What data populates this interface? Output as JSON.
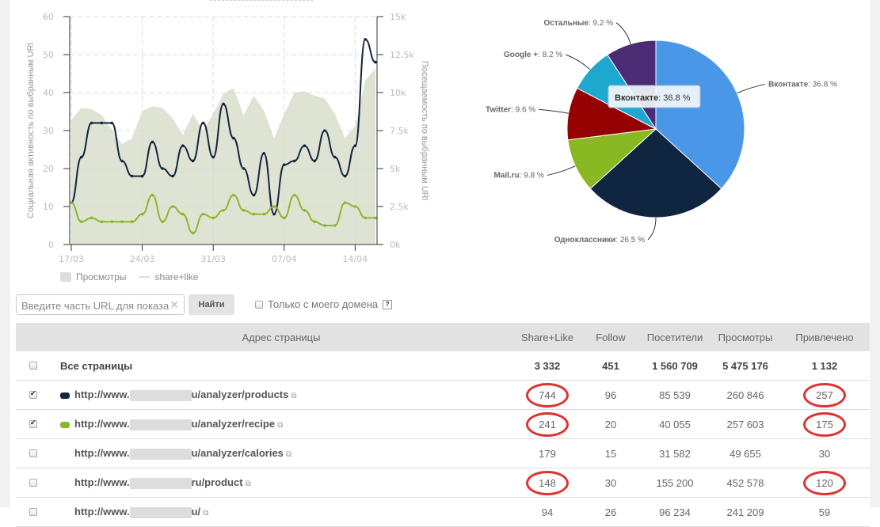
{
  "chart_data": [
    {
      "type": "line",
      "x_labels": [
        "17/03",
        "24/03",
        "31/03",
        "07/04",
        "14/04"
      ],
      "ylabel": "Социальная активность по выбранным URl",
      "y2label": "Посещаемость по выбранным URl",
      "ylim": [
        0,
        60
      ],
      "y2lim": [
        0,
        15000
      ],
      "yticks": [
        "0",
        "10",
        "20",
        "30",
        "40",
        "50",
        "60"
      ],
      "y2ticks": [
        "0k",
        "2.5k",
        "5k",
        "7.5k",
        "10k",
        "12.5k",
        "15k"
      ],
      "grid": true,
      "series": [
        {
          "name": "products",
          "axis": "left",
          "color": "#15273f",
          "values": [
            11,
            23,
            32,
            32,
            32,
            22,
            18,
            18,
            27,
            20,
            18,
            26,
            22,
            32,
            23,
            37,
            28,
            20,
            13,
            24,
            8,
            21,
            22,
            26,
            22,
            30,
            23,
            18,
            26,
            54,
            48
          ]
        },
        {
          "name": "recipe",
          "axis": "left",
          "color": "#8ab829",
          "values": [
            11,
            6,
            7,
            6,
            6,
            6,
            6,
            8,
            13,
            6,
            10,
            8,
            3,
            8,
            7,
            9,
            13,
            9,
            8,
            8,
            10,
            7,
            13,
            9,
            6,
            5,
            5,
            11,
            10,
            7,
            7
          ]
        },
        {
          "name": "Просмотры",
          "axis": "right",
          "type": "area",
          "color": "#d8decd",
          "values": [
            8200,
            9000,
            8900,
            8500,
            7600,
            6600,
            7000,
            8800,
            9100,
            9000,
            8300,
            7200,
            8600,
            7500,
            8600,
            9900,
            10300,
            8500,
            9800,
            8800,
            7000,
            8600,
            10000,
            10100,
            9800,
            9600,
            8600,
            7000,
            7800,
            10800,
            11600
          ]
        }
      ],
      "legend": [
        {
          "label": "Просмотры",
          "marker": "box"
        },
        {
          "label": "share+like",
          "marker": "line"
        }
      ]
    },
    {
      "type": "pie",
      "slices": [
        {
          "label": "Вконтакте",
          "value": 36.8,
          "color": "#4a97e8"
        },
        {
          "label": "Одноклассники",
          "value": 26.5,
          "color": "#0f2540"
        },
        {
          "label": "Mail.ru",
          "value": 9.8,
          "color": "#8ab822"
        },
        {
          "label": "Twitter",
          "value": 9.6,
          "color": "#950000"
        },
        {
          "label": "Google +",
          "value": 8.2,
          "color": "#1fa8cf"
        },
        {
          "label": "Остальные",
          "value": 9.2,
          "color": "#4c2c74"
        }
      ],
      "tooltip": {
        "label": "Вконтакте",
        "value": "36.8 %"
      }
    }
  ],
  "legend": {
    "views": "Просмотры",
    "sharelike": "share+like"
  },
  "search": {
    "placeholder": "Введите часть URL для показа",
    "clear": "✕",
    "button": "Найти",
    "domain_only": "Только с моего домена",
    "help": "?"
  },
  "table": {
    "headers": [
      "Адрес страницы",
      "Share+Like",
      "Follow",
      "Посетители",
      "Просмотры",
      "Привлечено"
    ],
    "total": {
      "label": "Все страницы",
      "cells": [
        "3 332",
        "451",
        "1 560 709",
        "5 475 176",
        "1 132"
      ]
    },
    "rows": [
      {
        "checked": true,
        "color": "#15273f",
        "prefix": "http://www.",
        "suffix": "u/analyzer/products",
        "cells": [
          "744",
          "96",
          "85 539",
          "260 846",
          "257"
        ],
        "marked": [
          true,
          false,
          false,
          false,
          true
        ]
      },
      {
        "checked": true,
        "color": "#8ab829",
        "prefix": "http://www.",
        "suffix": "u/analyzer/recipe",
        "cells": [
          "241",
          "20",
          "40 055",
          "257 603",
          "175"
        ],
        "marked": [
          true,
          false,
          false,
          false,
          true
        ]
      },
      {
        "checked": false,
        "color": "",
        "prefix": "http://www.",
        "suffix": "u/analyzer/calories",
        "cells": [
          "179",
          "15",
          "31 582",
          "49 655",
          "30"
        ],
        "marked": [
          false,
          false,
          false,
          false,
          false
        ]
      },
      {
        "checked": false,
        "color": "",
        "prefix": "http://www.",
        "suffix": "ru/product",
        "cells": [
          "148",
          "30",
          "155 200",
          "452 578",
          "120"
        ],
        "marked": [
          true,
          false,
          false,
          false,
          true
        ]
      },
      {
        "checked": false,
        "color": "",
        "prefix": "http://www.",
        "suffix": "u/",
        "cells": [
          "94",
          "26",
          "96 234",
          "241 209",
          "59"
        ],
        "marked": [
          false,
          false,
          false,
          false,
          false
        ]
      }
    ]
  }
}
